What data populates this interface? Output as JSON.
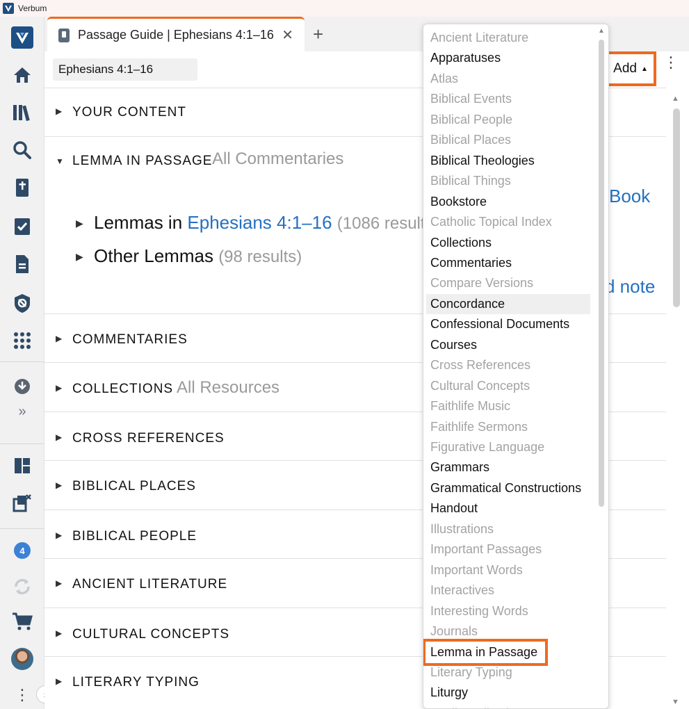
{
  "app": {
    "title": "Verbum"
  },
  "rail": {
    "notification_count": "4"
  },
  "tab": {
    "title": "Passage Guide | Ephesians 4:1–16",
    "close": "✕",
    "add": "+"
  },
  "toolbar": {
    "reference": "Ephesians 4:1–16",
    "add_label": "Add"
  },
  "sections": [
    {
      "title": "YOUR CONTENT",
      "subtitle": ""
    },
    {
      "title": "LEMMA IN PASSAGE",
      "subtitle": "All Commentaries"
    },
    {
      "title": "COMMENTARIES",
      "subtitle": ""
    },
    {
      "title": "COLLECTIONS",
      "subtitle": "All Resources"
    },
    {
      "title": "CROSS REFERENCES",
      "subtitle": ""
    },
    {
      "title": "BIBLICAL PLACES",
      "subtitle": ""
    },
    {
      "title": "BIBLICAL PEOPLE",
      "subtitle": ""
    },
    {
      "title": "ANCIENT LITERATURE",
      "subtitle": ""
    },
    {
      "title": "CULTURAL CONCEPTS",
      "subtitle": ""
    },
    {
      "title": "LITERARY TYPING",
      "subtitle": ""
    }
  ],
  "lemma": {
    "row1_prefix": "Lemmas in ",
    "row1_link": "Ephesians 4:1–16",
    "row1_count": "(1086 results)",
    "row2_label": "Other Lemmas",
    "row2_count": "(98 results)",
    "partial_link_1": "Book",
    "partial_link_2": "d note"
  },
  "dropdown": {
    "items": [
      {
        "label": "Ancient Literature",
        "enabled": false
      },
      {
        "label": "Apparatuses",
        "enabled": true
      },
      {
        "label": "Atlas",
        "enabled": false
      },
      {
        "label": "Biblical Events",
        "enabled": false
      },
      {
        "label": "Biblical People",
        "enabled": false
      },
      {
        "label": "Biblical Places",
        "enabled": false
      },
      {
        "label": "Biblical Theologies",
        "enabled": true
      },
      {
        "label": "Biblical Things",
        "enabled": false
      },
      {
        "label": "Bookstore",
        "enabled": true
      },
      {
        "label": "Catholic Topical Index",
        "enabled": false
      },
      {
        "label": "Collections",
        "enabled": true
      },
      {
        "label": "Commentaries",
        "enabled": true
      },
      {
        "label": "Compare Versions",
        "enabled": false
      },
      {
        "label": "Concordance",
        "enabled": true,
        "hover": true
      },
      {
        "label": "Confessional Documents",
        "enabled": true
      },
      {
        "label": "Courses",
        "enabled": true
      },
      {
        "label": "Cross References",
        "enabled": false
      },
      {
        "label": "Cultural Concepts",
        "enabled": false
      },
      {
        "label": "Faithlife Music",
        "enabled": false
      },
      {
        "label": "Faithlife Sermons",
        "enabled": false
      },
      {
        "label": "Figurative Language",
        "enabled": false
      },
      {
        "label": "Grammars",
        "enabled": true
      },
      {
        "label": "Grammatical Constructions",
        "enabled": true
      },
      {
        "label": "Handout",
        "enabled": true
      },
      {
        "label": "Illustrations",
        "enabled": false
      },
      {
        "label": "Important Passages",
        "enabled": false
      },
      {
        "label": "Important Words",
        "enabled": false
      },
      {
        "label": "Interactives",
        "enabled": false
      },
      {
        "label": "Interesting Words",
        "enabled": false
      },
      {
        "label": "Journals",
        "enabled": false
      },
      {
        "label": "Lemma in Passage",
        "enabled": true,
        "highlighted": true
      },
      {
        "label": "Literary Typing",
        "enabled": false
      },
      {
        "label": "Liturgy",
        "enabled": true
      },
      {
        "label": "Media Collections",
        "enabled": false
      }
    ]
  },
  "colors": {
    "accent": "#ee6a1f",
    "link": "#2470c2",
    "brand": "#1d4f84"
  }
}
